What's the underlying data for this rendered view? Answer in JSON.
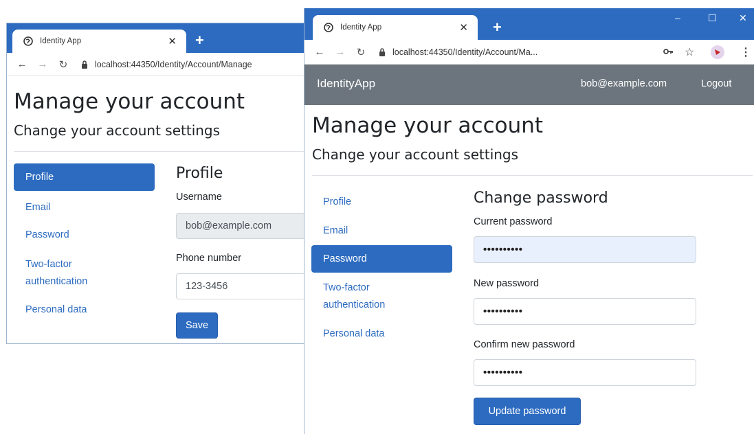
{
  "back_window": {
    "tab_title": "Identity App",
    "url": "localhost:44350/Identity/Account/Manage",
    "page_title": "Manage your account",
    "page_subtitle": "Change your account settings",
    "sidebar": [
      {
        "label": "Profile",
        "active": true
      },
      {
        "label": "Email",
        "active": false
      },
      {
        "label": "Password",
        "active": false
      },
      {
        "label": "Two-factor authentication",
        "active": false
      },
      {
        "label": "Personal data",
        "active": false
      }
    ],
    "section_title": "Profile",
    "username_label": "Username",
    "username_value": "bob@example.com",
    "phone_label": "Phone number",
    "phone_value": "123-3456",
    "save_label": "Save"
  },
  "front_window": {
    "tab_title": "Identity App",
    "url": "localhost:44350/Identity/Account/Ma...",
    "brand": "IdentityApp",
    "user": "bob@example.com",
    "logout": "Logout",
    "page_title": "Manage your account",
    "page_subtitle": "Change your account settings",
    "sidebar": [
      {
        "label": "Profile",
        "active": false
      },
      {
        "label": "Email",
        "active": false
      },
      {
        "label": "Password",
        "active": true
      },
      {
        "label": "Two-factor authentication",
        "active": false
      },
      {
        "label": "Personal data",
        "active": false
      }
    ],
    "section_title": "Change password",
    "current_password_label": "Current password",
    "current_password_value": "••••••••••",
    "new_password_label": "New password",
    "new_password_value": "••••••••••",
    "confirm_password_label": "Confirm new password",
    "confirm_password_value": "••••••••••",
    "update_label": "Update password"
  },
  "colors": {
    "accent": "#2c6bc0",
    "navbar": "#6c757d",
    "autofill": "#e8f0fe"
  },
  "icons": [
    "globe-icon",
    "close-tab-icon",
    "new-tab-icon",
    "back-icon",
    "forward-icon",
    "reload-icon",
    "lock-icon",
    "key-icon",
    "star-icon",
    "profile-avatar-icon",
    "menu-dots-icon",
    "minimize-icon",
    "maximize-icon",
    "close-window-icon"
  ]
}
